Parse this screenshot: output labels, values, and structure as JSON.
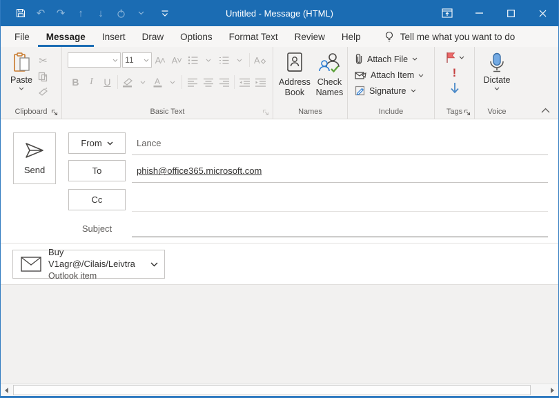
{
  "titlebar": {
    "title": "Untitled - Message (HTML)"
  },
  "menubar": {
    "tabs": [
      {
        "label": "File",
        "selected": false
      },
      {
        "label": "Message",
        "selected": true
      },
      {
        "label": "Insert",
        "selected": false
      },
      {
        "label": "Draw",
        "selected": false
      },
      {
        "label": "Options",
        "selected": false
      },
      {
        "label": "Format Text",
        "selected": false
      },
      {
        "label": "Review",
        "selected": false
      },
      {
        "label": "Help",
        "selected": false
      }
    ],
    "tellme": "Tell me what you want to do"
  },
  "ribbon": {
    "clipboard": {
      "paste_label": "Paste",
      "group_label": "Clipboard"
    },
    "basic_text": {
      "font_name_value": "",
      "font_size_value": "11",
      "bold_label": "B",
      "italic_label": "I",
      "underline_label": "U",
      "group_label": "Basic Text"
    },
    "names": {
      "address_book_label": "Address Book",
      "check_names_label": "Check Names",
      "group_label": "Names"
    },
    "include": {
      "attach_file_label": "Attach File",
      "attach_item_label": "Attach Item",
      "signature_label": "Signature",
      "group_label": "Include"
    },
    "tags": {
      "high_importance_glyph": "!",
      "group_label": "Tags"
    },
    "voice": {
      "dictate_label": "Dictate",
      "group_label": "Voice"
    }
  },
  "compose": {
    "send_label": "Send",
    "from_label": "From",
    "from_value": "Lance",
    "to_label": "To",
    "to_value": "phish@office365.microsoft.com",
    "cc_label": "Cc",
    "subject_label": "Subject"
  },
  "attachment": {
    "title": "Buy V1agr@/Cilais/Leivtra",
    "subtitle": "Outlook item"
  },
  "colors": {
    "titlebar_blue": "#1b6cb3",
    "accent_underline": "#1b6cb3",
    "paste_clipboard_orange": "#c8782a",
    "flag_red": "#e05c5c",
    "high_importance_red": "#c43e3e",
    "low_importance_blue": "#4a89c8",
    "dictate_mic_blue": "#74aae3",
    "check_names_green": "#5fa33c",
    "check_names_person_blue": "#2b7cd3",
    "signature_pen_blue": "#2b7cd3",
    "disabled_gray": "#b2b0ae",
    "text_dark": "#323130",
    "text_gray": "#605e5c"
  },
  "icons": {
    "save-icon": "floppy outline",
    "undo-icon": "↶",
    "redo-icon": "↷",
    "move-up-icon": "↑",
    "move-down-icon": "↓",
    "touch-mode-icon": "touch pointer",
    "customize-qat-icon": "bar + chevron-down",
    "ribbon-display-options-icon": "window with arrow",
    "minimize-icon": "─",
    "maximize-icon": "□",
    "close-icon": "✕",
    "lightbulb-icon": "bulb outline",
    "paste-icon": "clipboard + page",
    "cut-icon": "✂",
    "copy-icon": "two pages",
    "format-painter-icon": "brush",
    "bullets-icon": "dotted list",
    "numbering-icon": "numbered list",
    "clear-formatting-icon": "A + eraser",
    "highlight-icon": "pen over bar",
    "font-color-icon": "A over bar",
    "align-left-icon": "lines left",
    "align-center-icon": "lines center",
    "align-right-icon": "lines right",
    "decrease-indent-icon": "lines arrow left",
    "increase-indent-icon": "lines arrow right",
    "address-book-icon": "book with person",
    "check-names-icon": "two people + green check",
    "attach-file-icon": "paperclip",
    "attach-item-icon": "envelope",
    "signature-icon": "blue pen on page",
    "flag-icon": "red flag",
    "high-importance-icon": "red exclamation",
    "low-importance-icon": "blue down arrow",
    "dictate-icon": "blue microphone",
    "send-icon": "paper plane",
    "envelope-icon": "envelope",
    "chevron-down-icon": "⌄",
    "dialog-launcher-icon": "⇲",
    "collapse-ribbon-icon": "⌃",
    "scroll-left-icon": "◂",
    "scroll-right-icon": "▸"
  }
}
